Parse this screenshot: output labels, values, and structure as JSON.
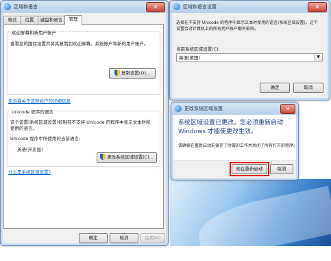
{
  "main_window": {
    "title": "区域和语言",
    "tabs": [
      "格式",
      "位置",
      "键盘和语言",
      "管理"
    ],
    "active_tab": "管理",
    "welcome": {
      "title": "欢迎屏幕和新用户帐户",
      "desc": "查看您的国际设置并将其复制到欢迎屏幕、系统帐户和新的用户帐户。",
      "copy_button": "复制设置(O)...",
      "link": "告诉我关于这些帐户的详细信息"
    },
    "unicode": {
      "title": "Unicode 程序的语言",
      "desc1": "这个设置(系统区域设置)控制在不支持 Unicode 的程序中显示文本时所",
      "desc2": "使用的语言。",
      "current_label": "Unicode 程序中所使用的当前语言:",
      "current_value": "英语(开买加)",
      "change_button": "更改系统区域设置(C)...",
      "link": "什么是系统区域设置?"
    },
    "footer": {
      "ok": "确定",
      "cancel": "取消",
      "apply": "应用(A)"
    }
  },
  "locale_dialog": {
    "title": "区域和语言设置",
    "desc1": "选择在不支持 Unicode 的程序中显示文本时使用的语言(系统区域设置)。这个",
    "desc2": "设置会对计算机上的所有用户帐户都有影响。",
    "label": "当前系统区域设置(C):",
    "selected": "英语(美国)",
    "ok": "确定",
    "cancel": "取消"
  },
  "restart_dialog": {
    "title": "更改系统区域设置",
    "line1": "系统区域设置已更改。您必须重新启动",
    "line2": "Windows 才能使更改生效。",
    "note": "请确保在重新启动前保存了所做的工作并关闭了所有打开的程序。",
    "restart_button": "现在重新启动",
    "cancel_button": "取消",
    "highlight_color": "#e21414"
  },
  "icons": {
    "close": "close-icon",
    "window": "globe-icon",
    "uac": "shield-icon"
  }
}
